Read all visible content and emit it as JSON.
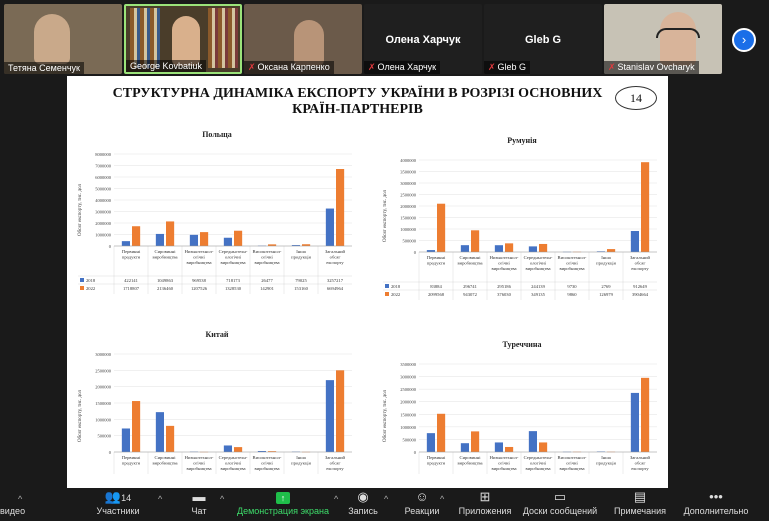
{
  "participants": [
    {
      "name": "Тетяна Семенчук",
      "muted": false,
      "video": true,
      "bg": "#7a6a55"
    },
    {
      "name": "George Kovbatiuk",
      "muted": false,
      "video": true,
      "bg": "#4a3d2a"
    },
    {
      "name": "Оксана Карпенко",
      "muted": true,
      "video": true,
      "bg": "#6b5a4a"
    },
    {
      "name": "Олена Харчук",
      "muted": true,
      "video": false,
      "bg": "#1f1f1f"
    },
    {
      "name": "Gleb G",
      "muted": true,
      "video": false,
      "bg": "#1f1f1f"
    },
    {
      "name": "Stanislav Ovcharyk",
      "muted": true,
      "video": true,
      "bg": "#c7c2b5"
    }
  ],
  "slide": {
    "title": "СТРУКТУРНА ДИНАМІКА ЕКСПОРТУ УКРАЇНИ В РОЗРІЗІ ОСНОВНИХ КРАЇН-ПАРТНЕРІВ",
    "number": "14"
  },
  "colors": {
    "s2018": "#4472c4",
    "s2022": "#ed7d31"
  },
  "chart_data": [
    {
      "type": "bar",
      "title": "Польща",
      "ylabel": "Обсяг експорту, тис. дол",
      "ylim": [
        0,
        8000000
      ],
      "yticks": [
        "0",
        "1000000",
        "2000000",
        "3000000",
        "4000000",
        "5000000",
        "6000000",
        "7000000",
        "8000000"
      ],
      "categories": [
        "Первинні продукти",
        "Сировинні виробництва",
        "Низькотехнологічні виробництва",
        "Середньотехнологічні виробництва",
        "Високотехнологічні виробництва",
        "Інша продукція",
        "Загальний обсяг експорту"
      ],
      "series": [
        {
          "name": "2018",
          "values": [
            422141,
            1049863,
            969538,
            718173,
            26477,
            79025,
            3257217
          ],
          "labels": [
            "422141",
            "1049863",
            "969538",
            "718173",
            "26477",
            "79025",
            "3257217"
          ]
        },
        {
          "name": "2022",
          "values": [
            1718807,
            2136460,
            1207526,
            1328530,
            142901,
            153160,
            6694964
          ],
          "labels": [
            "1718807",
            "2136460",
            "1207526",
            "1328530",
            "142901",
            "153160",
            "6694964"
          ]
        }
      ]
    },
    {
      "type": "bar",
      "title": "Румунія",
      "ylabel": "Обсяг експорту, тис. дол",
      "ylim": [
        0,
        4000000
      ],
      "yticks": [
        "0",
        "500000",
        "1000000",
        "1500000",
        "2000000",
        "2500000",
        "3000000",
        "3500000",
        "4000000"
      ],
      "categories": [
        "Первинні продукти",
        "Сировинні виробництва",
        "Низькотехнологічні виробництва",
        "Середньотехнологічні виробництва",
        "Високотехнологічні виробництва",
        "Інша продукція",
        "Загальний обсяг експорту"
      ],
      "series": [
        {
          "name": "2018",
          "values": [
            83884,
            296741,
            295186,
            244139,
            9730,
            27691,
            912649
          ],
          "labels": [
            "83884",
            "296741",
            "295186",
            "244139",
            "9730",
            "2769",
            "912649"
          ]
        },
        {
          "name": "2022",
          "values": [
            2099568,
            943072,
            376030,
            349135,
            9860,
            126979,
            3904664
          ],
          "labels": [
            "2099568",
            "943072",
            "376030",
            "349135",
            "9860",
            "126979",
            "3904664"
          ]
        }
      ]
    },
    {
      "type": "bar",
      "title": "Китай",
      "ylabel": "Обсяг експорту, тис. дол",
      "ylim": [
        0,
        3000000
      ],
      "yticks": [
        "0",
        "500000",
        "1000000",
        "1500000",
        "2000000",
        "2500000",
        "3000000"
      ],
      "categories": [
        "Первинні продукти",
        "Сировинні виробництва",
        "Низькотехнологічні виробництва",
        "Середньотехнологічні виробництва",
        "Високотехнологічні виробництва",
        "Інша продукція",
        "Загальний обсяг експорту"
      ],
      "series": [
        {
          "name": "2018",
          "values": [
            720000,
            1220000,
            10000,
            200000,
            30000,
            10000,
            2200000
          ]
        },
        {
          "name": "2022",
          "values": [
            1560000,
            800000,
            5000,
            150000,
            25000,
            5000,
            2500000
          ]
        }
      ]
    },
    {
      "type": "bar",
      "title": "Туреччина",
      "ylabel": "Обсяг експорту, тис. дол",
      "ylim": [
        0,
        3500000
      ],
      "yticks": [
        "0",
        "500000",
        "1000000",
        "1500000",
        "2000000",
        "2500000",
        "3000000",
        "3500000"
      ],
      "categories": [
        "Первинні продукти",
        "Сировинні виробництва",
        "Низькотехнологічні виробництва",
        "Середньотехнологічні виробництва",
        "Високотехнологічні виробництва",
        "Інша продукція",
        "Загальний обсяг експорту"
      ],
      "series": [
        {
          "name": "2018",
          "values": [
            750000,
            350000,
            380000,
            830000,
            10000,
            20000,
            2350000
          ]
        },
        {
          "name": "2022",
          "values": [
            1520000,
            820000,
            200000,
            380000,
            10000,
            10000,
            2950000
          ]
        }
      ]
    }
  ],
  "toolbar": {
    "video_label": "видео",
    "participants_label": "Участники",
    "participants_count": "14",
    "chat_label": "Чат",
    "share_label": "Демонстрация экрана",
    "record_label": "Запись",
    "reactions_label": "Реакции",
    "apps_label": "Приложения",
    "whiteboard_label": "Доски сообщений",
    "notes_label": "Примечания",
    "more_label": "Дополнительно"
  },
  "icons": [
    "chevron-right-icon",
    "mic-muted-icon",
    "participants-icon",
    "chat-icon",
    "share-screen-icon",
    "record-icon",
    "reactions-icon",
    "apps-icon",
    "whiteboard-icon",
    "notes-icon",
    "more-icon",
    "caret-up-icon"
  ]
}
